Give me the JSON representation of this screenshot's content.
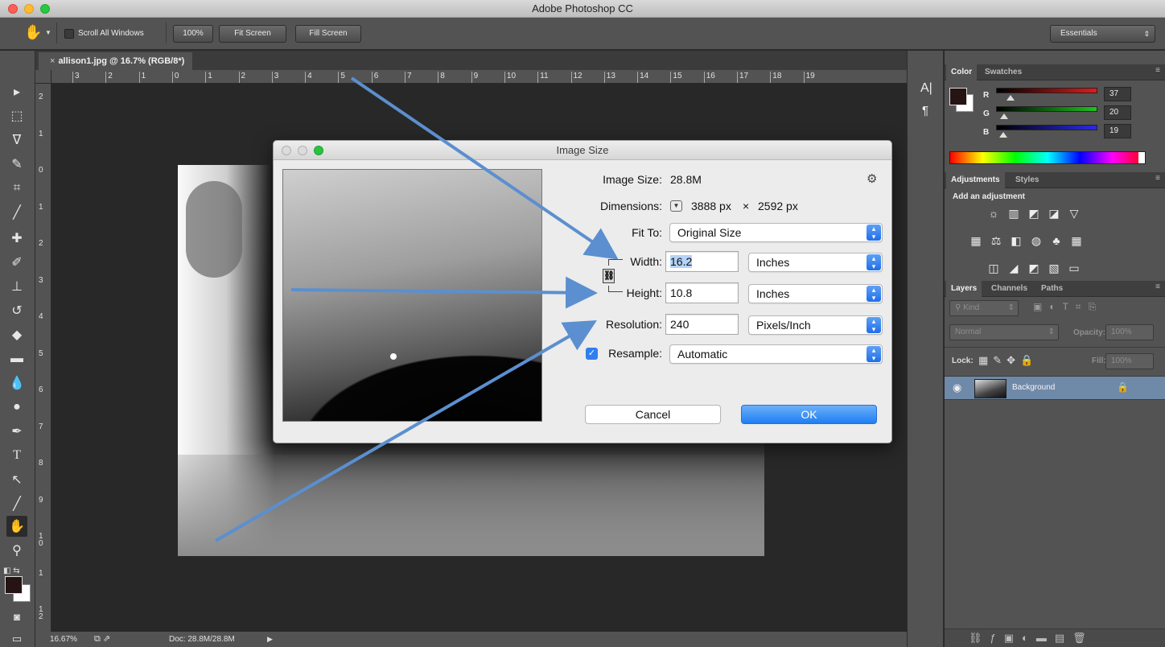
{
  "window": {
    "title": "Adobe Photoshop CC"
  },
  "options_bar": {
    "scroll_all_windows": "Scroll All Windows",
    "zoom_100": "100%",
    "fit_screen": "Fit Screen",
    "fill_screen": "Fill Screen",
    "workspace": "Essentials"
  },
  "document": {
    "tab_title": "allison1.jpg @ 16.7% (RGB/8*)",
    "close_glyph": "×",
    "h_ruler": [
      "3",
      "2",
      "1",
      "0",
      "1",
      "2",
      "3",
      "4",
      "5",
      "6",
      "7",
      "8",
      "9",
      "10",
      "11",
      "12",
      "13",
      "14",
      "15",
      "16",
      "17",
      "18",
      "19"
    ],
    "v_ruler": [
      "2",
      "1",
      "0",
      "1",
      "2",
      "3",
      "4",
      "5",
      "6",
      "7",
      "8",
      "9",
      "1\n0",
      "1",
      "1\n2"
    ]
  },
  "status_bar": {
    "zoom": "16.67%",
    "doc_info": "Doc: 28.8M/28.8M"
  },
  "color_panel": {
    "tabs": [
      "Color",
      "Swatches"
    ],
    "channels": [
      {
        "label": "R",
        "value": "37",
        "color": "#e31b1b",
        "fill": 0.145
      },
      {
        "label": "G",
        "value": "20",
        "color": "#1ec21e",
        "fill": 0.078
      },
      {
        "label": "B",
        "value": "19",
        "color": "#2a2ae6",
        "fill": 0.075
      }
    ],
    "foreground": "#251413"
  },
  "adjustments_panel": {
    "tabs": [
      "Adjustments",
      "Styles"
    ],
    "heading": "Add an adjustment",
    "icons": [
      [
        "brightness-icon",
        "levels-icon",
        "curves-icon",
        "exposure-icon",
        "vibrance-icon"
      ],
      [
        "hue-saturation-icon",
        "color-balance-icon",
        "black-white-icon",
        "photo-filter-icon",
        "channel-mixer-icon",
        "color-lookup-icon"
      ],
      [
        "invert-icon",
        "posterize-icon",
        "threshold-icon",
        "selective-color-icon",
        "gradient-map-icon"
      ]
    ]
  },
  "layers_panel": {
    "tabs": [
      "Layers",
      "Channels",
      "Paths"
    ],
    "filter": "Kind",
    "blend_mode": "Normal",
    "opacity_label": "Opacity:",
    "opacity_value": "100%",
    "lock_label": "Lock:",
    "fill_label": "Fill:",
    "fill_value": "100%",
    "layer_name": "Background"
  },
  "image_size_dialog": {
    "title": "Image Size",
    "image_size_label": "Image Size:",
    "image_size_value": "28.8M",
    "dimensions_label": "Dimensions:",
    "dim_width": "3888 px",
    "dim_x": "×",
    "dim_height": "2592 px",
    "fit_to_label": "Fit To:",
    "fit_to_value": "Original Size",
    "width_label": "Width:",
    "width_value": "16.2",
    "width_unit": "Inches",
    "height_label": "Height:",
    "height_value": "10.8",
    "height_unit": "Inches",
    "resolution_label": "Resolution:",
    "resolution_value": "240",
    "resolution_unit": "Pixels/Inch",
    "resample_label": "Resample:",
    "resample_value": "Automatic",
    "resample_checked": true,
    "cancel": "Cancel",
    "ok": "OK"
  },
  "annotation_color": "#5b8fcf"
}
